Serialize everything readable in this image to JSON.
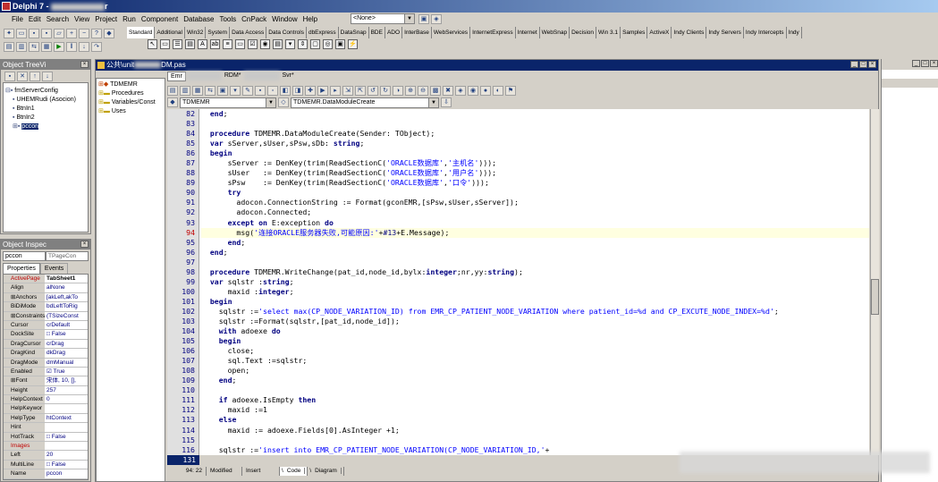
{
  "app": {
    "title": "Delphi 7 - ",
    "title_suffix": "r"
  },
  "menu": [
    "File",
    "Edit",
    "Search",
    "View",
    "Project",
    "Run",
    "Component",
    "Database",
    "Tools",
    "CnPack",
    "Window",
    "Help"
  ],
  "config_select": "<None>",
  "palette_tabs": [
    "Standard",
    "Additional",
    "Win32",
    "System",
    "Data Access",
    "Data Controls",
    "dbExpress",
    "DataSnap",
    "BDE",
    "ADO",
    "InterBase",
    "WebServices",
    "InternetExpress",
    "Internet",
    "WebSnap",
    "Decision",
    "Win 3.1",
    "Samples",
    "ActiveX",
    "Indy Clients",
    "Indy Servers",
    "Indy Intercepts",
    "Indy"
  ],
  "object_tree": {
    "title": "Object TreeVi",
    "items": [
      "fmServerConfig",
      "UHEMRudi (Asocion)",
      "BtnIn1",
      "BtnIn2",
      "pccon"
    ]
  },
  "object_inspector": {
    "title": "Object Inspec",
    "selected": "pccon",
    "selected_type": "TPageCon",
    "tabs": [
      "Properties",
      "Events"
    ],
    "rows": [
      {
        "k": "ActivePage",
        "v": "TabSheet1",
        "red": true
      },
      {
        "k": "Align",
        "v": "alNone"
      },
      {
        "k": "⊞Anchors",
        "v": "[akLeft,akTo"
      },
      {
        "k": "BiDiMode",
        "v": "bdLeftToRig"
      },
      {
        "k": "⊞Constraints",
        "v": "(TSizeConst"
      },
      {
        "k": "Cursor",
        "v": "crDefault"
      },
      {
        "k": "DockSite",
        "v": "□ False"
      },
      {
        "k": "DragCursor",
        "v": "crDrag"
      },
      {
        "k": "DragKind",
        "v": "dkDrag"
      },
      {
        "k": "DragMode",
        "v": "dmManual"
      },
      {
        "k": "Enabled",
        "v": "☑ True"
      },
      {
        "k": "⊞Font",
        "v": "宋体, 10, [],"
      },
      {
        "k": "Height",
        "v": "257"
      },
      {
        "k": "HelpContext",
        "v": "0"
      },
      {
        "k": "HelpKeywor",
        "v": ""
      },
      {
        "k": "HelpType",
        "v": "htContext"
      },
      {
        "k": "Hint",
        "v": ""
      },
      {
        "k": "HotTrack",
        "v": "□ False"
      },
      {
        "k": "Images",
        "v": "",
        "red": true
      },
      {
        "k": "Left",
        "v": "20"
      },
      {
        "k": "MultiLine",
        "v": "□ False"
      },
      {
        "k": "Name",
        "v": "pccon"
      }
    ]
  },
  "editor": {
    "title": "公共\\unit",
    "title_suffix": "DM.pas",
    "file_tabs": [
      "Emr",
      "RDM*",
      "Svr*"
    ],
    "explorer": [
      "TDMEMR",
      "Procedures",
      "Variables/Const",
      "Uses"
    ],
    "class_select": "TDMEMR",
    "method_select": "TDMEMR.DataModuleCreate",
    "current_line": "131",
    "status": {
      "pos": "94: 22",
      "modified": "Modified",
      "mode": "Insert",
      "tabs": [
        "Code",
        "Diagram"
      ]
    },
    "lines": [
      {
        "n": "82",
        "t": "  end;"
      },
      {
        "n": "83",
        "t": ""
      },
      {
        "n": "84",
        "t": "  procedure TDMEMR.DataModuleCreate(Sender: TObject);"
      },
      {
        "n": "85",
        "t": "  var sServer,sUser,sPsw,sDb: string;"
      },
      {
        "n": "86",
        "t": "  begin"
      },
      {
        "n": "87",
        "t": "      sServer := DenKey(trim(ReadSectionC('ORACLE数据库','主机名')));"
      },
      {
        "n": "88",
        "t": "      sUser   := DenKey(trim(ReadSectionC('ORACLE数据库','用户名')));"
      },
      {
        "n": "89",
        "t": "      sPsw    := DenKey(trim(ReadSectionC('ORACLE数据库','口令')));"
      },
      {
        "n": "90",
        "t": "      try"
      },
      {
        "n": "91",
        "t": "        adocon.ConnectionString := Format(gconEMR,[sPsw,sUser,sServer]);"
      },
      {
        "n": "92",
        "t": "        adocon.Connected;"
      },
      {
        "n": "93",
        "t": "      except on E:exception do"
      },
      {
        "n": "94",
        "t": "        msg('连接ORACLE服务器失败,可能原因:'+#13+E.Message);",
        "hl": true
      },
      {
        "n": "95",
        "t": "      end;"
      },
      {
        "n": "96",
        "t": "  end;"
      },
      {
        "n": "97",
        "t": ""
      },
      {
        "n": "98",
        "t": "  procedure TDMEMR.WriteChange(pat_id,node_id,bylx:integer;nr,yy:string);"
      },
      {
        "n": "99",
        "t": "  var sqlstr :string;"
      },
      {
        "n": "100",
        "t": "      maxid :integer;"
      },
      {
        "n": "101",
        "t": "  begin"
      },
      {
        "n": "102",
        "t": "    sqlstr :='select max(CP_NODE_VARIATION_ID) from EMR_CP_PATIENT_NODE_VARIATION where patient_id=%d and CP_EXCUTE_NODE_INDEX=%d';"
      },
      {
        "n": "103",
        "t": "    sqlstr :=Format(sqlstr,[pat_id,node_id]);"
      },
      {
        "n": "104",
        "t": "    with adoexe do"
      },
      {
        "n": "105",
        "t": "    begin"
      },
      {
        "n": "106",
        "t": "      close;"
      },
      {
        "n": "107",
        "t": "      sql.Text :=sqlstr;"
      },
      {
        "n": "108",
        "t": "      open;"
      },
      {
        "n": "109",
        "t": "    end;"
      },
      {
        "n": "110",
        "t": ""
      },
      {
        "n": "111",
        "t": "    if adoexe.IsEmpty then"
      },
      {
        "n": "112",
        "t": "      maxid :=1"
      },
      {
        "n": "113",
        "t": "    else"
      },
      {
        "n": "114",
        "t": "      maxid := adoexe.Fields[0].AsInteger +1;"
      },
      {
        "n": "115",
        "t": ""
      },
      {
        "n": "116",
        "t": "    sqlstr :='insert into EMR_CP_PATIENT_NODE_VARIATION(CP_NODE_VARIATION_ID,'+"
      }
    ]
  }
}
